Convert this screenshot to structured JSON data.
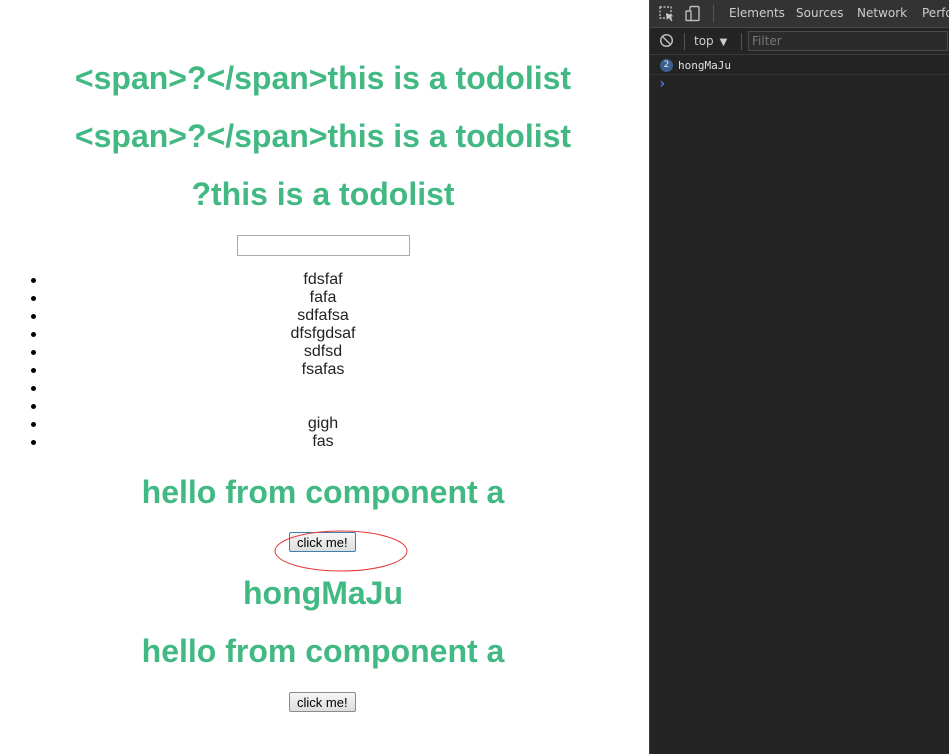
{
  "page": {
    "headings": [
      "<span>?</span>this is a todolist",
      "<span>?</span>this is a todolist",
      "?this is a todolist"
    ],
    "todo_input": {
      "value": "",
      "placeholder": ""
    },
    "todo_items": [
      "fdsfaf",
      "fafa",
      "sdfafsa",
      "dfsfgdsaf",
      "sdfsd",
      "fsafas",
      "",
      "",
      "gigh",
      "fas"
    ],
    "component_a_1": {
      "heading": "hello from component a",
      "button_label": "click me!"
    },
    "message": "hongMaJu",
    "component_a_2": {
      "heading": "hello from component a",
      "button_label": "click me!"
    },
    "heading_color": "#42b983",
    "annotation_color": "#e53935"
  },
  "devtools": {
    "tabs": [
      "Elements",
      "Sources",
      "Network",
      "Perfo"
    ],
    "context": "top",
    "filter_placeholder": "Filter",
    "console_log": {
      "count": "2",
      "text": "hongMaJu"
    },
    "prompt": "›",
    "icons": [
      "inspect-icon",
      "device-toggle-icon",
      "clear-console-icon"
    ]
  }
}
